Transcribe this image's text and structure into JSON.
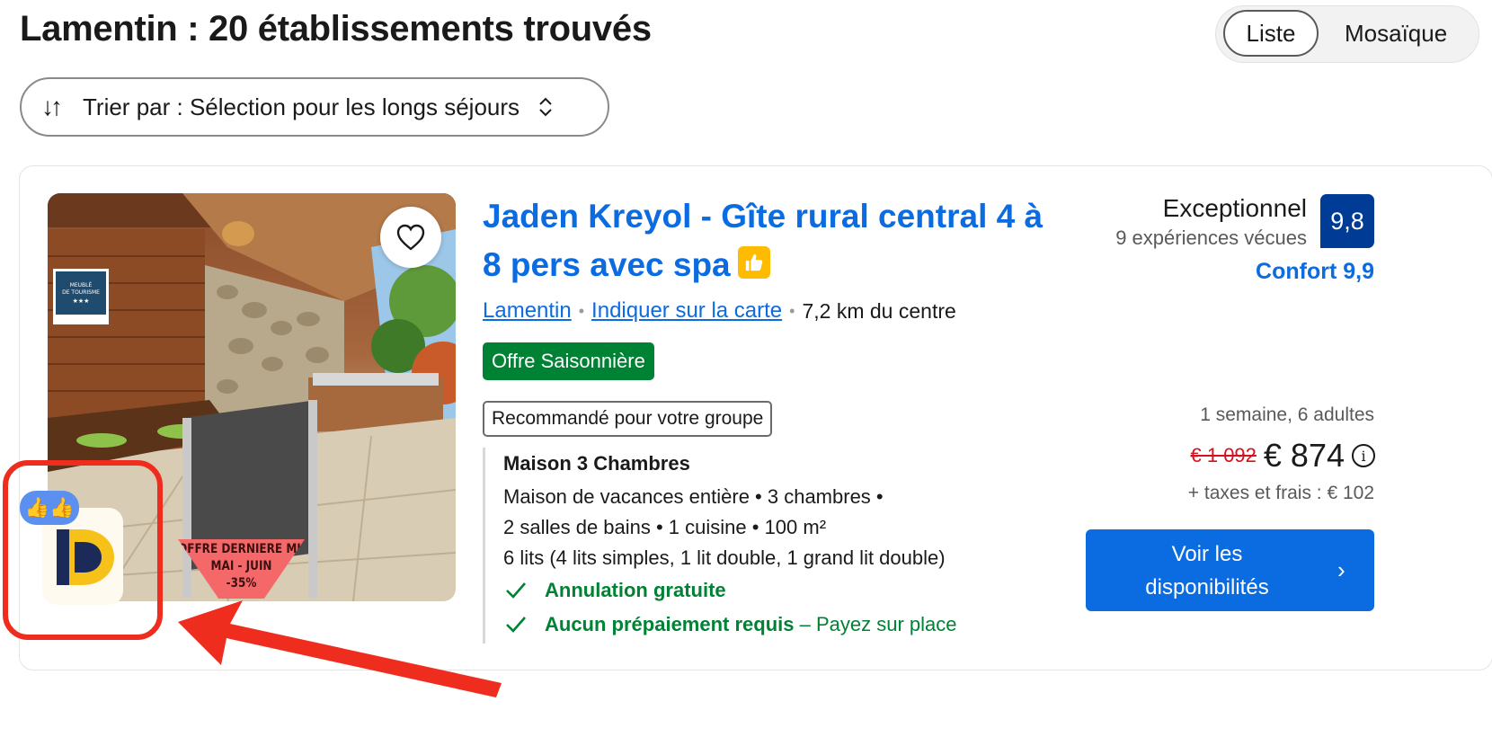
{
  "header": {
    "title": "Lamentin : 20 établissements trouvés",
    "view_toggle": {
      "list_label": "Liste",
      "mosaic_label": "Mosaïque",
      "selected": "Liste"
    },
    "sort": {
      "arrows": "↓↑",
      "label": "Trier par : Sélection pour les longs séjours",
      "chevron_up": "⌃",
      "chevron_down": "⌄"
    }
  },
  "listing": {
    "photo": {
      "sign_lines": [
        "MEUBLÉ",
        "DE TOURISME",
        "★★★"
      ],
      "promo_lines": [
        "OFFRE DERNIERE MINUTE",
        "MAI - JUIN",
        "-35%"
      ]
    },
    "logo": {
      "badge": "👍👍",
      "letter": "D"
    },
    "title": "Jaden Kreyol - Gîte rural central 4 à 8 pers avec spa",
    "location": {
      "city": "Lamentin",
      "map_link": "Indiquer sur la carte",
      "separator": "•",
      "distance": "7,2 km du centre"
    },
    "seasonal_badge": "Offre Saisonnière",
    "group_badge": "Recommandé pour votre groupe",
    "unit": {
      "title": "Maison 3 Chambres",
      "lines": [
        "Maison de vacances entière • 3 chambres •",
        "2 salles de bains • 1 cuisine • 100 m²",
        "6 lits (4 lits simples, 1 lit double, 1 grand lit double)"
      ]
    },
    "benefits": {
      "cancellation": "Annulation gratuite",
      "prepayment_strong": "Aucun prépaiement requis",
      "prepayment_rest": " – Payez sur place"
    },
    "rating": {
      "word": "Exceptionnel",
      "reviews": "9 expériences vécues",
      "score": "9,8",
      "comfort": "Confort 9,9"
    },
    "pricing": {
      "stay": "1 semaine, 6 adultes",
      "old_price": "€ 1 092",
      "new_price": "€ 874",
      "info": "i",
      "taxes": "+ taxes et frais : € 102"
    },
    "cta": {
      "line1": "Voir les",
      "line2": "disponibilités",
      "chevron": "›"
    }
  },
  "colors": {
    "brand_blue": "#0b6be0",
    "score_blue": "#003b95",
    "green": "#008234",
    "price_red": "#d4111e",
    "annotation_red": "#ee2d1f",
    "like_yellow": "#febb02"
  }
}
